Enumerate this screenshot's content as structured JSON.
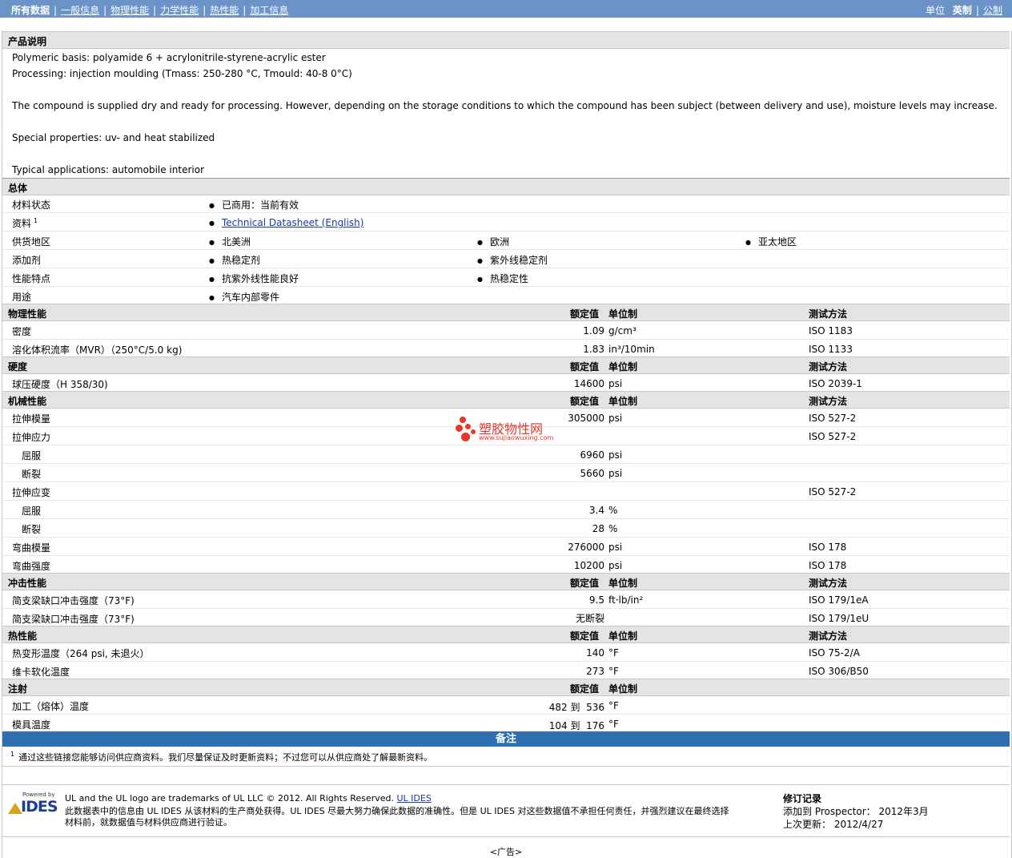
{
  "nav": {
    "all_data": "所有数据",
    "tabs": [
      "一般信息",
      "物理性能",
      "力学性能",
      "热性能",
      "加工信息"
    ],
    "unit_label": "单位",
    "unit_english": "英制",
    "unit_metric": "公制"
  },
  "product": {
    "heading": "产品说明",
    "lines": [
      "Polymeric basis: polyamide 6 + acrylonitrile-styrene-acrylic ester",
      "Processing: injection moulding (Tmass: 250-280 °C, Tmould: 40-8 0°C)",
      "The compound is supplied dry and ready for processing. However, depending on the storage conditions to which the compound has been subject (between delivery and use), moisture levels may increase.",
      "Special properties: uv- and heat stabilized",
      "Typical applications: automobile interior"
    ]
  },
  "general": {
    "heading": "总体",
    "rows": [
      {
        "label": "材料状态",
        "items": [
          "已商用：当前有效"
        ]
      },
      {
        "label": "资料",
        "sup": "1",
        "link": "Technical Datasheet (English)"
      },
      {
        "label": "供货地区",
        "items": [
          "北美洲",
          "欧洲",
          "亚太地区"
        ]
      },
      {
        "label": "添加剂",
        "items": [
          "热稳定剂",
          "紫外线稳定剂"
        ]
      },
      {
        "label": "性能特点",
        "items": [
          "抗紫外线性能良好",
          "热稳定性"
        ]
      },
      {
        "label": "用途",
        "items": [
          "汽车内部零件"
        ]
      }
    ]
  },
  "col_headers": {
    "nominal": "额定值",
    "unit": "单位制",
    "method": "测试方法"
  },
  "physical": {
    "heading": "物理性能",
    "rows": [
      {
        "label": "密度",
        "value": "1.09",
        "unit": "g/cm³",
        "method": "ISO 1183"
      },
      {
        "label": "溶化体积流率（MVR）（250°C/5.0 kg)",
        "value": "1.83",
        "unit": "in³/10min",
        "method": "ISO 1133"
      }
    ]
  },
  "hardness": {
    "heading": "硬度",
    "rows": [
      {
        "label": "球压硬度（H 358/30)",
        "value": "14600",
        "unit": "psi",
        "method": "ISO 2039-1"
      }
    ]
  },
  "mechanical": {
    "heading": "机械性能",
    "rows": [
      {
        "label": "拉伸模量",
        "value": "305000",
        "unit": "psi",
        "method": "ISO 527-2"
      },
      {
        "label": "拉伸应力",
        "value": "",
        "unit": "",
        "method": "ISO 527-2"
      },
      {
        "label": "屈服",
        "value": "6960",
        "unit": "psi",
        "method": "",
        "sub": true
      },
      {
        "label": "断裂",
        "value": "5660",
        "unit": "psi",
        "method": "",
        "sub": true
      },
      {
        "label": "拉伸应变",
        "value": "",
        "unit": "",
        "method": "ISO 527-2"
      },
      {
        "label": "屈服",
        "value": "3.4",
        "unit": "%",
        "method": "",
        "sub": true
      },
      {
        "label": "断裂",
        "value": "28",
        "unit": "%",
        "method": "",
        "sub": true
      },
      {
        "label": "弯曲模量",
        "value": "276000",
        "unit": "psi",
        "method": "ISO 178"
      },
      {
        "label": "弯曲强度",
        "value": "10200",
        "unit": "psi",
        "method": "ISO 178"
      }
    ]
  },
  "impact": {
    "heading": "冲击性能",
    "rows": [
      {
        "label": "简支梁缺口冲击强度（73°F)",
        "value": "9.5",
        "unit": "ft·lb/in²",
        "method": "ISO 179/1eA"
      },
      {
        "label": "简支梁缺口冲击强度（73°F)",
        "value": "无断裂",
        "unit": "",
        "method": "ISO 179/1eU"
      }
    ]
  },
  "thermal": {
    "heading": "热性能",
    "rows": [
      {
        "label": "热变形温度（264 psi, 未退火）",
        "value": "140",
        "unit": "°F",
        "method": "ISO 75-2/A"
      },
      {
        "label": "维卡软化温度",
        "value": "273",
        "unit": "°F",
        "method": "ISO 306/B50"
      }
    ]
  },
  "injection": {
    "heading": "注射",
    "rows": [
      {
        "label": "加工（熔体）温度",
        "value": "482 到  536",
        "unit": "°F"
      },
      {
        "label": "模具温度",
        "value": "104 到  176",
        "unit": "°F"
      }
    ]
  },
  "notes": {
    "heading": "备注",
    "sup": "1",
    "text": "通过这些链接您能够访问供应商资料。我们尽量保证及时更新资料；不过您可以从供应商处了解最新资料。"
  },
  "watermark": {
    "title": "塑胶物性网",
    "url": "www.sujiaowuxing.com"
  },
  "footer": {
    "logo_powered": "Powered by",
    "logo_name": "IDES",
    "line1": "UL and the UL logo are trademarks of UL LLC © 2012. All Rights Reserved.",
    "line1_link": "UL IDES",
    "line2": "此数据表中的信息由  UL IDES 从该材料的生产商处获得。UL IDES 尽最大努力确保此数据的准确性。但是  UL IDES 对这些数据值不承担任何责任，并强烈建议在最终选择",
    "line3": "材料前，就数据值与材料供应商进行验证。",
    "rev_title": "修订记录",
    "rev_added": "添加到  Prospector：  2012年3月",
    "rev_updated": "上次更新：   2012/4/27"
  },
  "ad": "<广告>"
}
